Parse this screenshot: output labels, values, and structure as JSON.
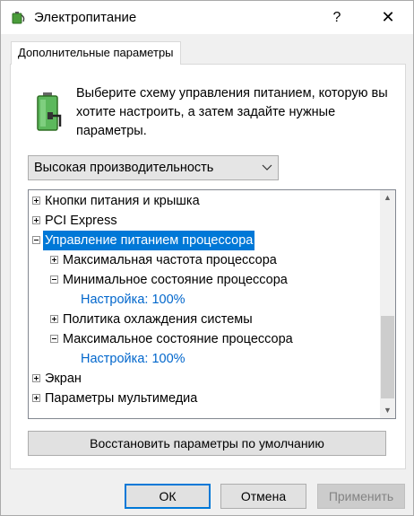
{
  "window": {
    "title": "Электропитание",
    "help_label": "?",
    "close_label": "✕"
  },
  "tab": {
    "label": "Дополнительные параметры"
  },
  "description": "Выберите схему управления питанием, которую вы хотите настроить, а затем задайте нужные параметры.",
  "plan_select": {
    "value": "Высокая производительность"
  },
  "tree": {
    "items": [
      {
        "label": "Кнопки питания и крышка",
        "level": 0,
        "toggle": "plus"
      },
      {
        "label": "PCI Express",
        "level": 0,
        "toggle": "plus"
      },
      {
        "label": "Управление питанием процессора",
        "level": 0,
        "toggle": "minus",
        "selected": true
      },
      {
        "label": "Максимальная частота процессора",
        "level": 1,
        "toggle": "plus"
      },
      {
        "label": "Минимальное состояние процессора",
        "level": 1,
        "toggle": "minus"
      },
      {
        "label": "Настройка: 100%",
        "level": 2,
        "toggle": "none"
      },
      {
        "label": "Политика охлаждения системы",
        "level": 1,
        "toggle": "plus"
      },
      {
        "label": "Максимальное состояние процессора",
        "level": 1,
        "toggle": "minus"
      },
      {
        "label": "Настройка: 100%",
        "level": 2,
        "toggle": "none"
      },
      {
        "label": "Экран",
        "level": 0,
        "toggle": "plus"
      },
      {
        "label": "Параметры мультимедиа",
        "level": 0,
        "toggle": "plus"
      }
    ]
  },
  "buttons": {
    "restore": "Восстановить параметры по умолчанию",
    "ok": "ОК",
    "cancel": "Отмена",
    "apply": "Применить"
  },
  "colors": {
    "selection": "#0078d7",
    "setting_text": "#0066cc"
  }
}
